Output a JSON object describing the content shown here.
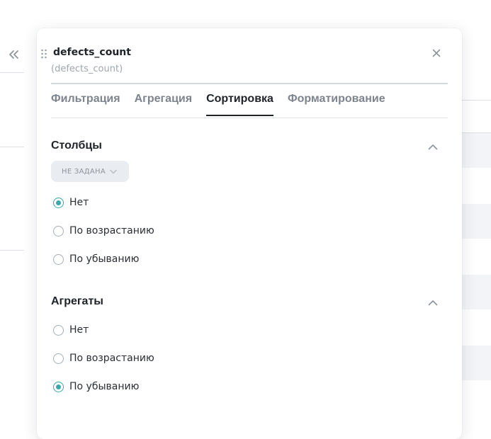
{
  "background": {
    "collapse_icon": "chevrons-double-left-icon"
  },
  "panel": {
    "title": "defects_count",
    "subtitle": "(defects_count)",
    "drag_icon": "drag-handle-icon",
    "close_icon": "close-icon",
    "tabs": [
      {
        "label": "Фильтрация",
        "active": false
      },
      {
        "label": "Агрегация",
        "active": false
      },
      {
        "label": "Сортировка",
        "active": true
      },
      {
        "label": "Форматирование",
        "active": false
      }
    ],
    "sections": {
      "columns": {
        "title": "Столбцы",
        "toggle_icon": "chevron-up-icon",
        "chip_label": "НЕ ЗАДАНА",
        "chip_icon": "chevron-down-icon",
        "options": [
          {
            "label": "Нет",
            "checked": true
          },
          {
            "label": "По возрастанию",
            "checked": false
          },
          {
            "label": "По убыванию",
            "checked": false
          }
        ]
      },
      "aggregates": {
        "title": "Агрегаты",
        "toggle_icon": "chevron-up-icon",
        "options": [
          {
            "label": "Нет",
            "checked": false
          },
          {
            "label": "По возрастанию",
            "checked": false
          },
          {
            "label": "По убыванию",
            "checked": true
          }
        ]
      }
    }
  },
  "colors": {
    "accent": "#3aa8a8",
    "text": "#1f2328",
    "muted": "#7d848e"
  }
}
